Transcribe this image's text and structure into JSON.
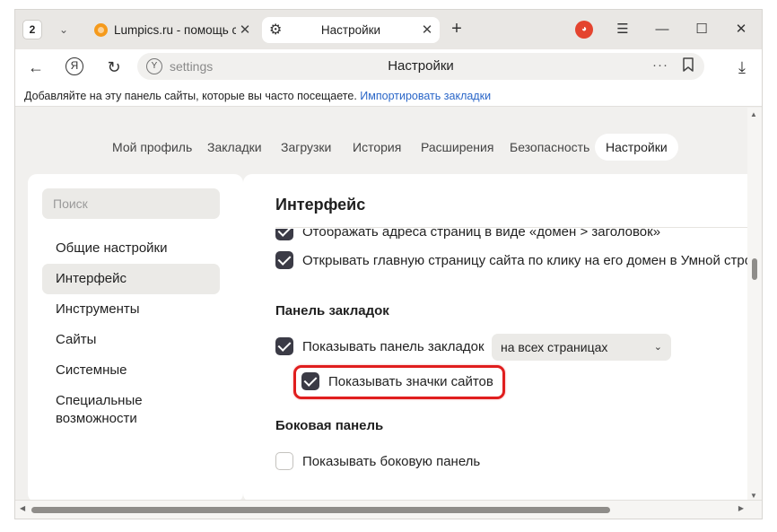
{
  "tabstrip": {
    "tab_count": "2",
    "tabs": [
      {
        "title": "Lumpics.ru - помощь с к",
        "favicon": "orange-circle-icon"
      },
      {
        "title": "Настройки",
        "favicon": "gear-icon"
      }
    ],
    "new_tab": "+",
    "avatar": "◕"
  },
  "address_bar": {
    "url": "settings",
    "page_title": "Настройки",
    "more": "···"
  },
  "bookmarks_bar": {
    "hint": "Добавляйте на эту панель сайты, которые вы часто посещаете.",
    "import_link": "Импортировать закладки"
  },
  "nav": {
    "items": [
      "Мой профиль",
      "Закладки",
      "Загрузки",
      "История",
      "Расширения",
      "Безопасность",
      "Настройки"
    ],
    "active": "Настройки"
  },
  "sidebar": {
    "search_placeholder": "Поиск",
    "items": [
      "Общие настройки",
      "Интерфейс",
      "Инструменты",
      "Сайты",
      "Системные",
      "Специальные возможности"
    ],
    "active": "Интерфейс"
  },
  "content": {
    "title": "Интерфейс",
    "options_top": [
      {
        "label": "Отображать адреса страниц в виде «домен > заголовок»",
        "checked": true
      },
      {
        "label": "Открывать главную страницу сайта по клику на его домен в Умной строке",
        "checked": true
      }
    ],
    "bookmarks_section": {
      "heading": "Панель закладок",
      "show_bar": {
        "label": "Показывать панель закладок",
        "checked": true
      },
      "show_bar_select": "на всех страницах",
      "show_icons": {
        "label": "Показывать значки сайтов",
        "checked": true
      }
    },
    "side_panel_section": {
      "heading": "Боковая панель",
      "show_panel": {
        "label": "Показывать боковую панель",
        "checked": false
      }
    }
  },
  "colors": {
    "highlight": "#e01e1e",
    "link": "#2a66c8",
    "checkbox": "#3b3b46",
    "favicon": "#f59a1c"
  }
}
